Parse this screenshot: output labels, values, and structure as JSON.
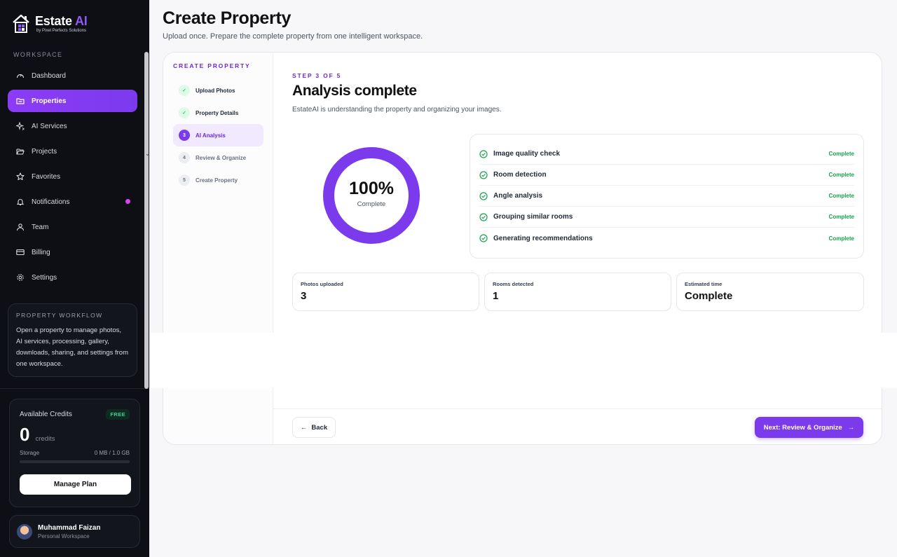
{
  "brand": {
    "name": "Estate",
    "name_accent": "AI",
    "sub": "by Pixel Perfects Solutions"
  },
  "sidebar": {
    "section_label": "WORKSPACE",
    "items": [
      {
        "label": "Dashboard",
        "icon": "gauge-icon"
      },
      {
        "label": "Properties",
        "icon": "folder-icon",
        "active": true
      },
      {
        "label": "AI Services",
        "icon": "sparkles-icon"
      },
      {
        "label": "Projects",
        "icon": "folder-open-icon"
      },
      {
        "label": "Favorites",
        "icon": "star-icon"
      },
      {
        "label": "Notifications",
        "icon": "bell-icon",
        "dot": true
      },
      {
        "label": "Team",
        "icon": "users-icon"
      },
      {
        "label": "Billing",
        "icon": "card-icon"
      },
      {
        "label": "Settings",
        "icon": "gear-icon"
      }
    ],
    "workflow": {
      "title": "PROPERTY WORKFLOW",
      "body": "Open a property to manage photos, AI services, processing, gallery, downloads, sharing, and settings from one workspace."
    },
    "credits": {
      "label": "Available Credits",
      "badge": "FREE",
      "amount": "0",
      "unit": "credits",
      "storage_label": "Storage",
      "storage_value": "0 MB / 1.0 GB",
      "storage_fraction": 0,
      "button": "Manage Plan"
    },
    "user": {
      "name": "Muhammad Faizan",
      "sub": "Personal Workspace"
    }
  },
  "page": {
    "title": "Create Property",
    "subtitle": "Upload once. Prepare the complete property from one intelligent workspace."
  },
  "steps": {
    "title": "CREATE PROPERTY",
    "items": [
      {
        "num": "✓",
        "label": "Upload Photos",
        "state": "done"
      },
      {
        "num": "✓",
        "label": "Property Details",
        "state": "done"
      },
      {
        "num": "3",
        "label": "AI Analysis",
        "state": "active"
      },
      {
        "num": "4",
        "label": "Review & Organize",
        "state": "todo"
      },
      {
        "num": "5",
        "label": "Create Property",
        "state": "todo"
      }
    ]
  },
  "analysis": {
    "kicker": "STEP 3 OF 5",
    "heading": "Analysis complete",
    "description": "EstateAI is understanding the property and organizing your images.",
    "progress_pct": "100%",
    "progress_value": 1.0,
    "progress_label": "Complete",
    "checks": [
      {
        "label": "Image quality check",
        "status": "Complete"
      },
      {
        "label": "Room detection",
        "status": "Complete"
      },
      {
        "label": "Angle analysis",
        "status": "Complete"
      },
      {
        "label": "Grouping similar rooms",
        "status": "Complete"
      },
      {
        "label": "Generating recommendations",
        "status": "Complete"
      }
    ],
    "stats": [
      {
        "label": "Photos uploaded",
        "value": "3"
      },
      {
        "label": "Rooms detected",
        "value": "1"
      },
      {
        "label": "Estimated time",
        "value": "Complete"
      }
    ]
  },
  "footer": {
    "back": "Back",
    "next": "Next: Review & Organize"
  },
  "colors": {
    "accent": "#7c3aed",
    "success": "#16a34a",
    "sidebar_bg": "#0d0f14"
  }
}
